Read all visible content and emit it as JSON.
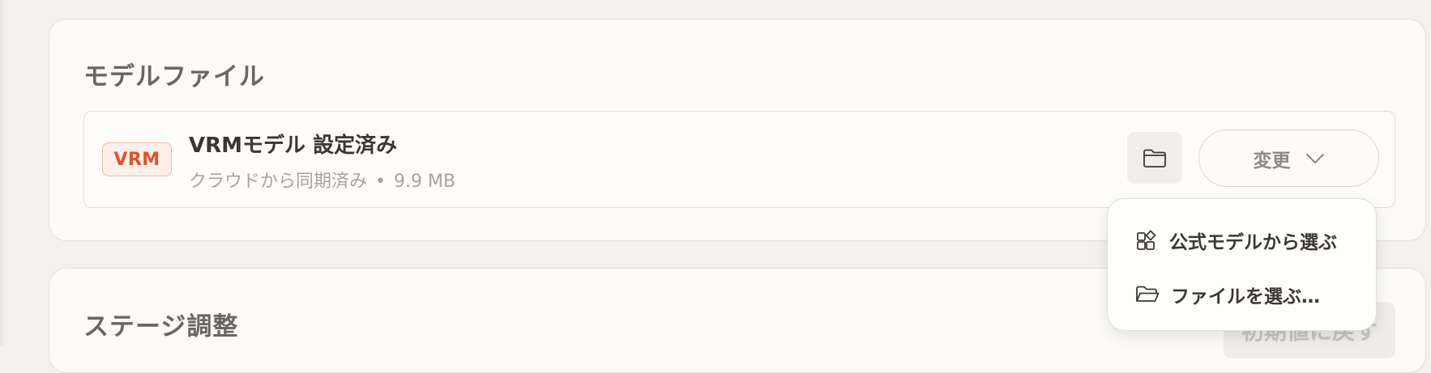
{
  "model_section": {
    "title": "モデルファイル",
    "file": {
      "badge": "VRM",
      "title": "VRMモデル 設定済み",
      "status": "クラウドから同期済み",
      "separator": "•",
      "size": "9.9 MB"
    },
    "folder_icon": "folder-icon",
    "change_button": {
      "label": "変更",
      "icon": "chevron-down-icon"
    }
  },
  "dropdown": {
    "items": [
      {
        "label": "公式モデルから選ぶ",
        "icon": "widgets-icon"
      },
      {
        "label": "ファイルを選ぶ…",
        "icon": "folder-open-icon"
      }
    ]
  },
  "stage_section": {
    "title": "ステージ調整",
    "reset_button": "初期値に戻す"
  },
  "colors": {
    "background": "#f3f1ed",
    "card": "#fcfbf8",
    "badge_text": "#e0522e",
    "badge_bg": "#fdeee9"
  }
}
